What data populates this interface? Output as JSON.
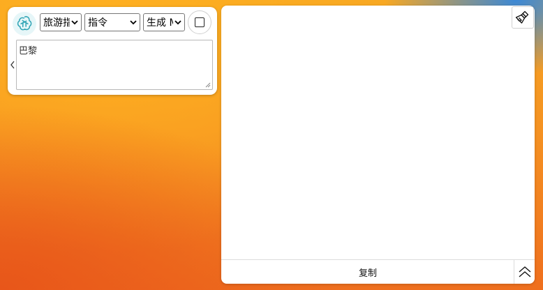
{
  "left_panel": {
    "logo_icon": "chatgpt-logo-icon",
    "selects": {
      "scene": "旅游指南",
      "mode": "指令",
      "model": "生成 Markdown"
    },
    "input_value": "巴黎",
    "toggle_icon": "square-icon",
    "collapse_icon": "chevron-left-icon"
  },
  "right_panel": {
    "clear_icon": "broom-icon",
    "output_text": "",
    "copy_label": "复制",
    "scroll_top_icon": "double-chevron-up-icon"
  },
  "colors": {
    "logo_bg": "#e6f6f8",
    "logo_stroke": "#2fa4b5",
    "panel_bg": "#ffffff"
  }
}
